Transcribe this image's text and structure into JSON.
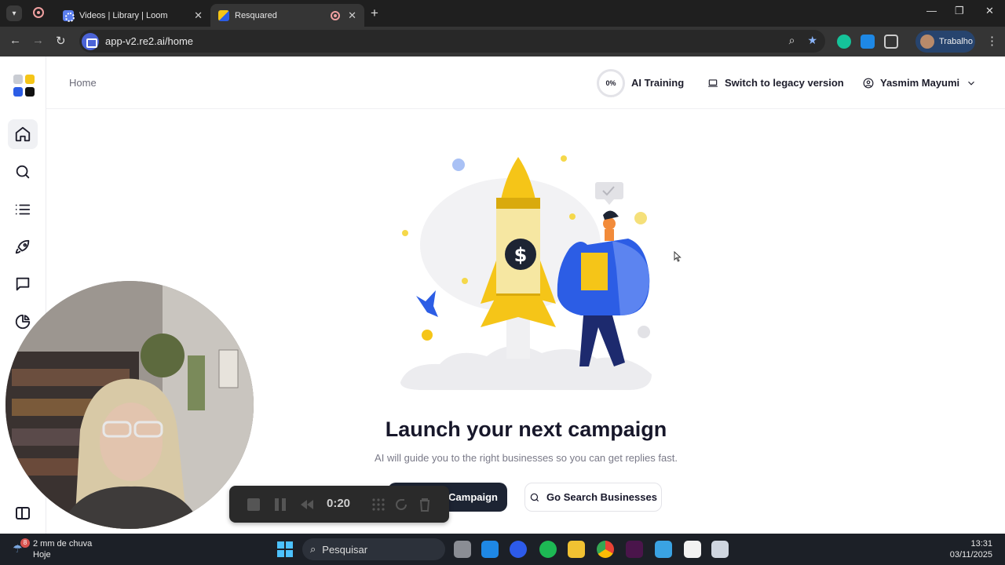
{
  "browser": {
    "tabs": [
      {
        "title": "Videos | Library | Loom"
      },
      {
        "title": "Resquared"
      }
    ],
    "url": "app-v2.re2.ai/home",
    "profile": "Trabalho"
  },
  "app": {
    "breadcrumb": "Home",
    "ai_training": {
      "percent_label": "0%",
      "label": "AI Training"
    },
    "legacy_label": "Switch to legacy version",
    "user_name": "Yasmim Mayumi",
    "hero": {
      "headline": "Launch your next campaign",
      "subtitle": "AI will guide you to the right businesses so you can get replies fast.",
      "primary_button": "Campaign",
      "secondary_button": "Go Search Businesses"
    },
    "sidebar_icons": [
      "home-icon",
      "search-icon",
      "list-icon",
      "rocket-icon",
      "chat-icon",
      "pie-chart-icon"
    ]
  },
  "recorder": {
    "timer": "0:20"
  },
  "taskbar": {
    "weather_badge": "8",
    "weather_line1": "2 mm de chuva",
    "weather_line2": "Hoje",
    "search_placeholder": "Pesquisar",
    "time": "13:31",
    "date": "03/11/2025"
  },
  "colors": {
    "brand_yellow": "#f5c518",
    "brand_blue": "#2c5de5",
    "primary_button": "#1d2433"
  }
}
